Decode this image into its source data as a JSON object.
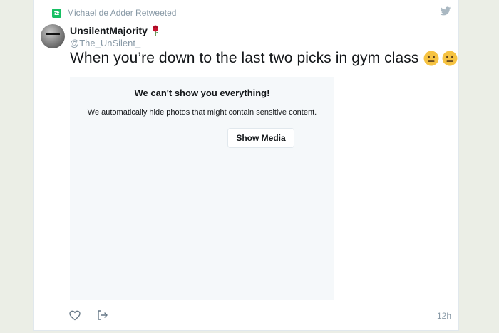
{
  "retweet": {
    "text": "Michael de Adder Retweeted",
    "icon": "retweet-icon",
    "color": "#17bf63"
  },
  "header": {
    "logo_icon": "twitter-bird-icon",
    "logo_color": "#aab8c2"
  },
  "author": {
    "display_name": "UnsilentMajority",
    "name_emoji": "rose-emoji",
    "handle": "@The_UnSilent_"
  },
  "tweet": {
    "text": "When you’re down to the last two picks in gym class",
    "emojis": [
      "neutral-face-emoji",
      "neutral-face-emoji"
    ]
  },
  "media_warning": {
    "title": "We can't show you everything!",
    "body": "We automatically hide photos that might contain sensitive content.",
    "button_label": "Show Media"
  },
  "footer": {
    "like_icon": "heart-icon",
    "share_icon": "share-icon",
    "timestamp": "12h"
  },
  "colors": {
    "text_primary": "#14171a",
    "text_secondary": "#8899a6",
    "media_background": "#f5f8fa"
  }
}
